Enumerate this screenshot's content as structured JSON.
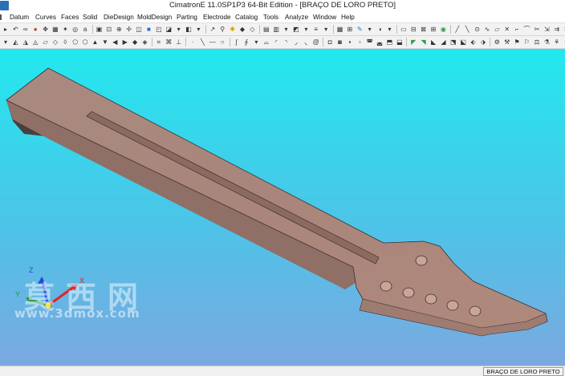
{
  "window": {
    "title": "CimatronE 11.0SP1P3 64-Bit Edition - [BRAÇO DE LORO PRETO]"
  },
  "menu": {
    "items": [
      "Datum",
      "Curves",
      "Faces",
      "Solid",
      "DieDesign",
      "MoldDesign",
      "Parting",
      "Electrode",
      "Catalog",
      "Tools",
      "Analyze",
      "Window",
      "Help"
    ]
  },
  "viewport": {
    "background_top": "#22e8ee",
    "background_bottom": "#7ca8e0",
    "model_color": "#a9857b",
    "axes": {
      "x": "X",
      "y": "Y",
      "z": "Z"
    }
  },
  "watermark": {
    "chinese": "莫西网",
    "url": "www.3dmox.com"
  },
  "status": {
    "document": "BRAÇO DE LORO PRETO"
  }
}
